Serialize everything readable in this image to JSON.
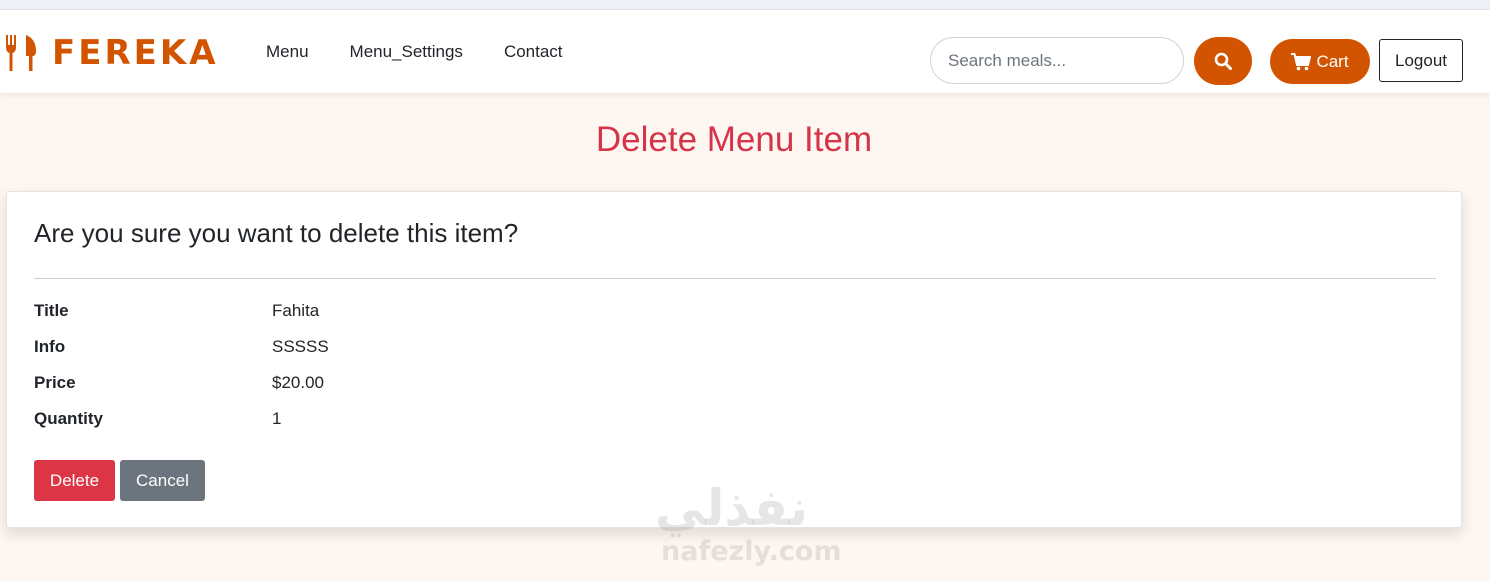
{
  "brand": {
    "name": "FEREKA",
    "icon": "fork-knife-icon",
    "color": "#d35400"
  },
  "nav": {
    "links": [
      "Menu",
      "Menu_Settings",
      "Contact"
    ]
  },
  "search": {
    "placeholder": "Search meals...",
    "value": "",
    "icon": "search-icon"
  },
  "header_actions": {
    "cart_label": "Cart",
    "cart_icon": "cart-icon",
    "logout_label": "Logout"
  },
  "page": {
    "title": "Delete Menu Item"
  },
  "confirm": {
    "heading": "Are you sure you want to delete this item?",
    "details": [
      {
        "label": "Title",
        "value": "Fahita"
      },
      {
        "label": "Info",
        "value": "SSSSS"
      },
      {
        "label": "Price",
        "value": "$20.00"
      },
      {
        "label": "Quantity",
        "value": "1"
      }
    ],
    "delete_label": "Delete",
    "cancel_label": "Cancel"
  },
  "watermark": {
    "arabic": "نفذلي",
    "latin": "nafezly.com"
  },
  "colors": {
    "accent": "#d35400",
    "title": "#d63448",
    "danger": "#dc3545",
    "secondary": "#6c757d",
    "background": "#fdf6f1"
  }
}
